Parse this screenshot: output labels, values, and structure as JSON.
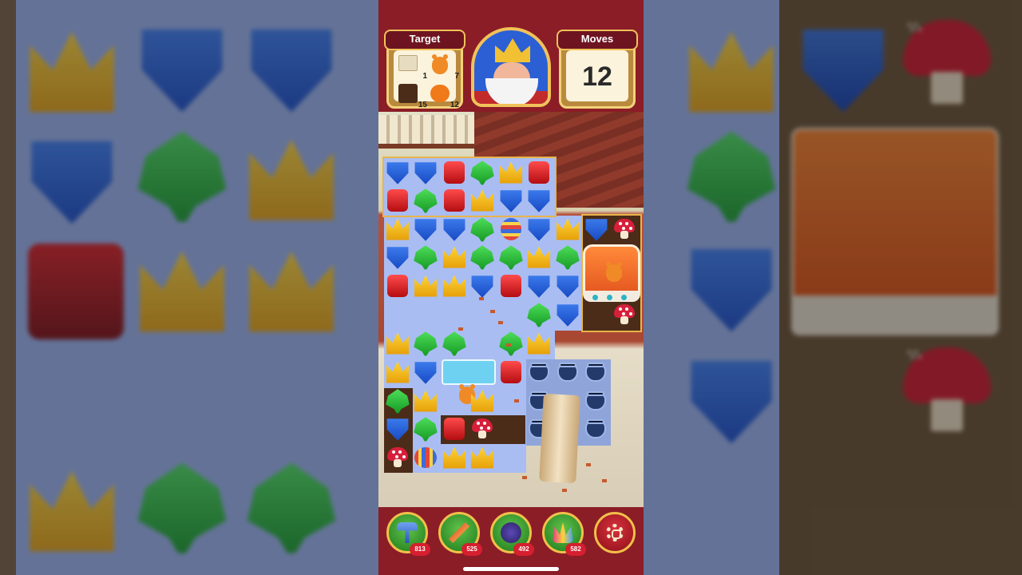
{
  "hud": {
    "target_label": "Target",
    "moves_label": "Moves",
    "moves_value": "12",
    "targets": [
      {
        "icon": "paper-icon",
        "count": "1"
      },
      {
        "icon": "teddy-bear-icon",
        "count": "7"
      },
      {
        "icon": "soil-icon",
        "count": "15"
      },
      {
        "icon": "pumpkin-icon",
        "count": "12"
      }
    ]
  },
  "boosters": [
    {
      "name": "hammer-booster",
      "count": "813"
    },
    {
      "name": "arrow-booster",
      "count": "525"
    },
    {
      "name": "cannon-booster",
      "count": "492"
    },
    {
      "name": "jester-hat-booster",
      "count": "582"
    }
  ]
}
